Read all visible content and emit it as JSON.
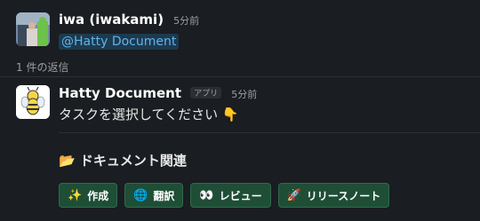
{
  "message1": {
    "author": "iwa (iwakami)",
    "time": "5分前",
    "mention": "@Hatty Document"
  },
  "thread": {
    "reply_count": "1 件の返信"
  },
  "message2": {
    "author": "Hatty Document",
    "badge": "アプリ",
    "time": "5分前",
    "text": "タスクを選択してください 👇"
  },
  "section": {
    "icon": "📂",
    "title": "ドキュメント関連"
  },
  "buttons": [
    {
      "icon": "✨",
      "label": "作成"
    },
    {
      "icon": "🌐",
      "label": "翻訳"
    },
    {
      "icon": "👀",
      "label": "レビュー"
    },
    {
      "icon": "🚀",
      "label": "リリースノート"
    }
  ]
}
